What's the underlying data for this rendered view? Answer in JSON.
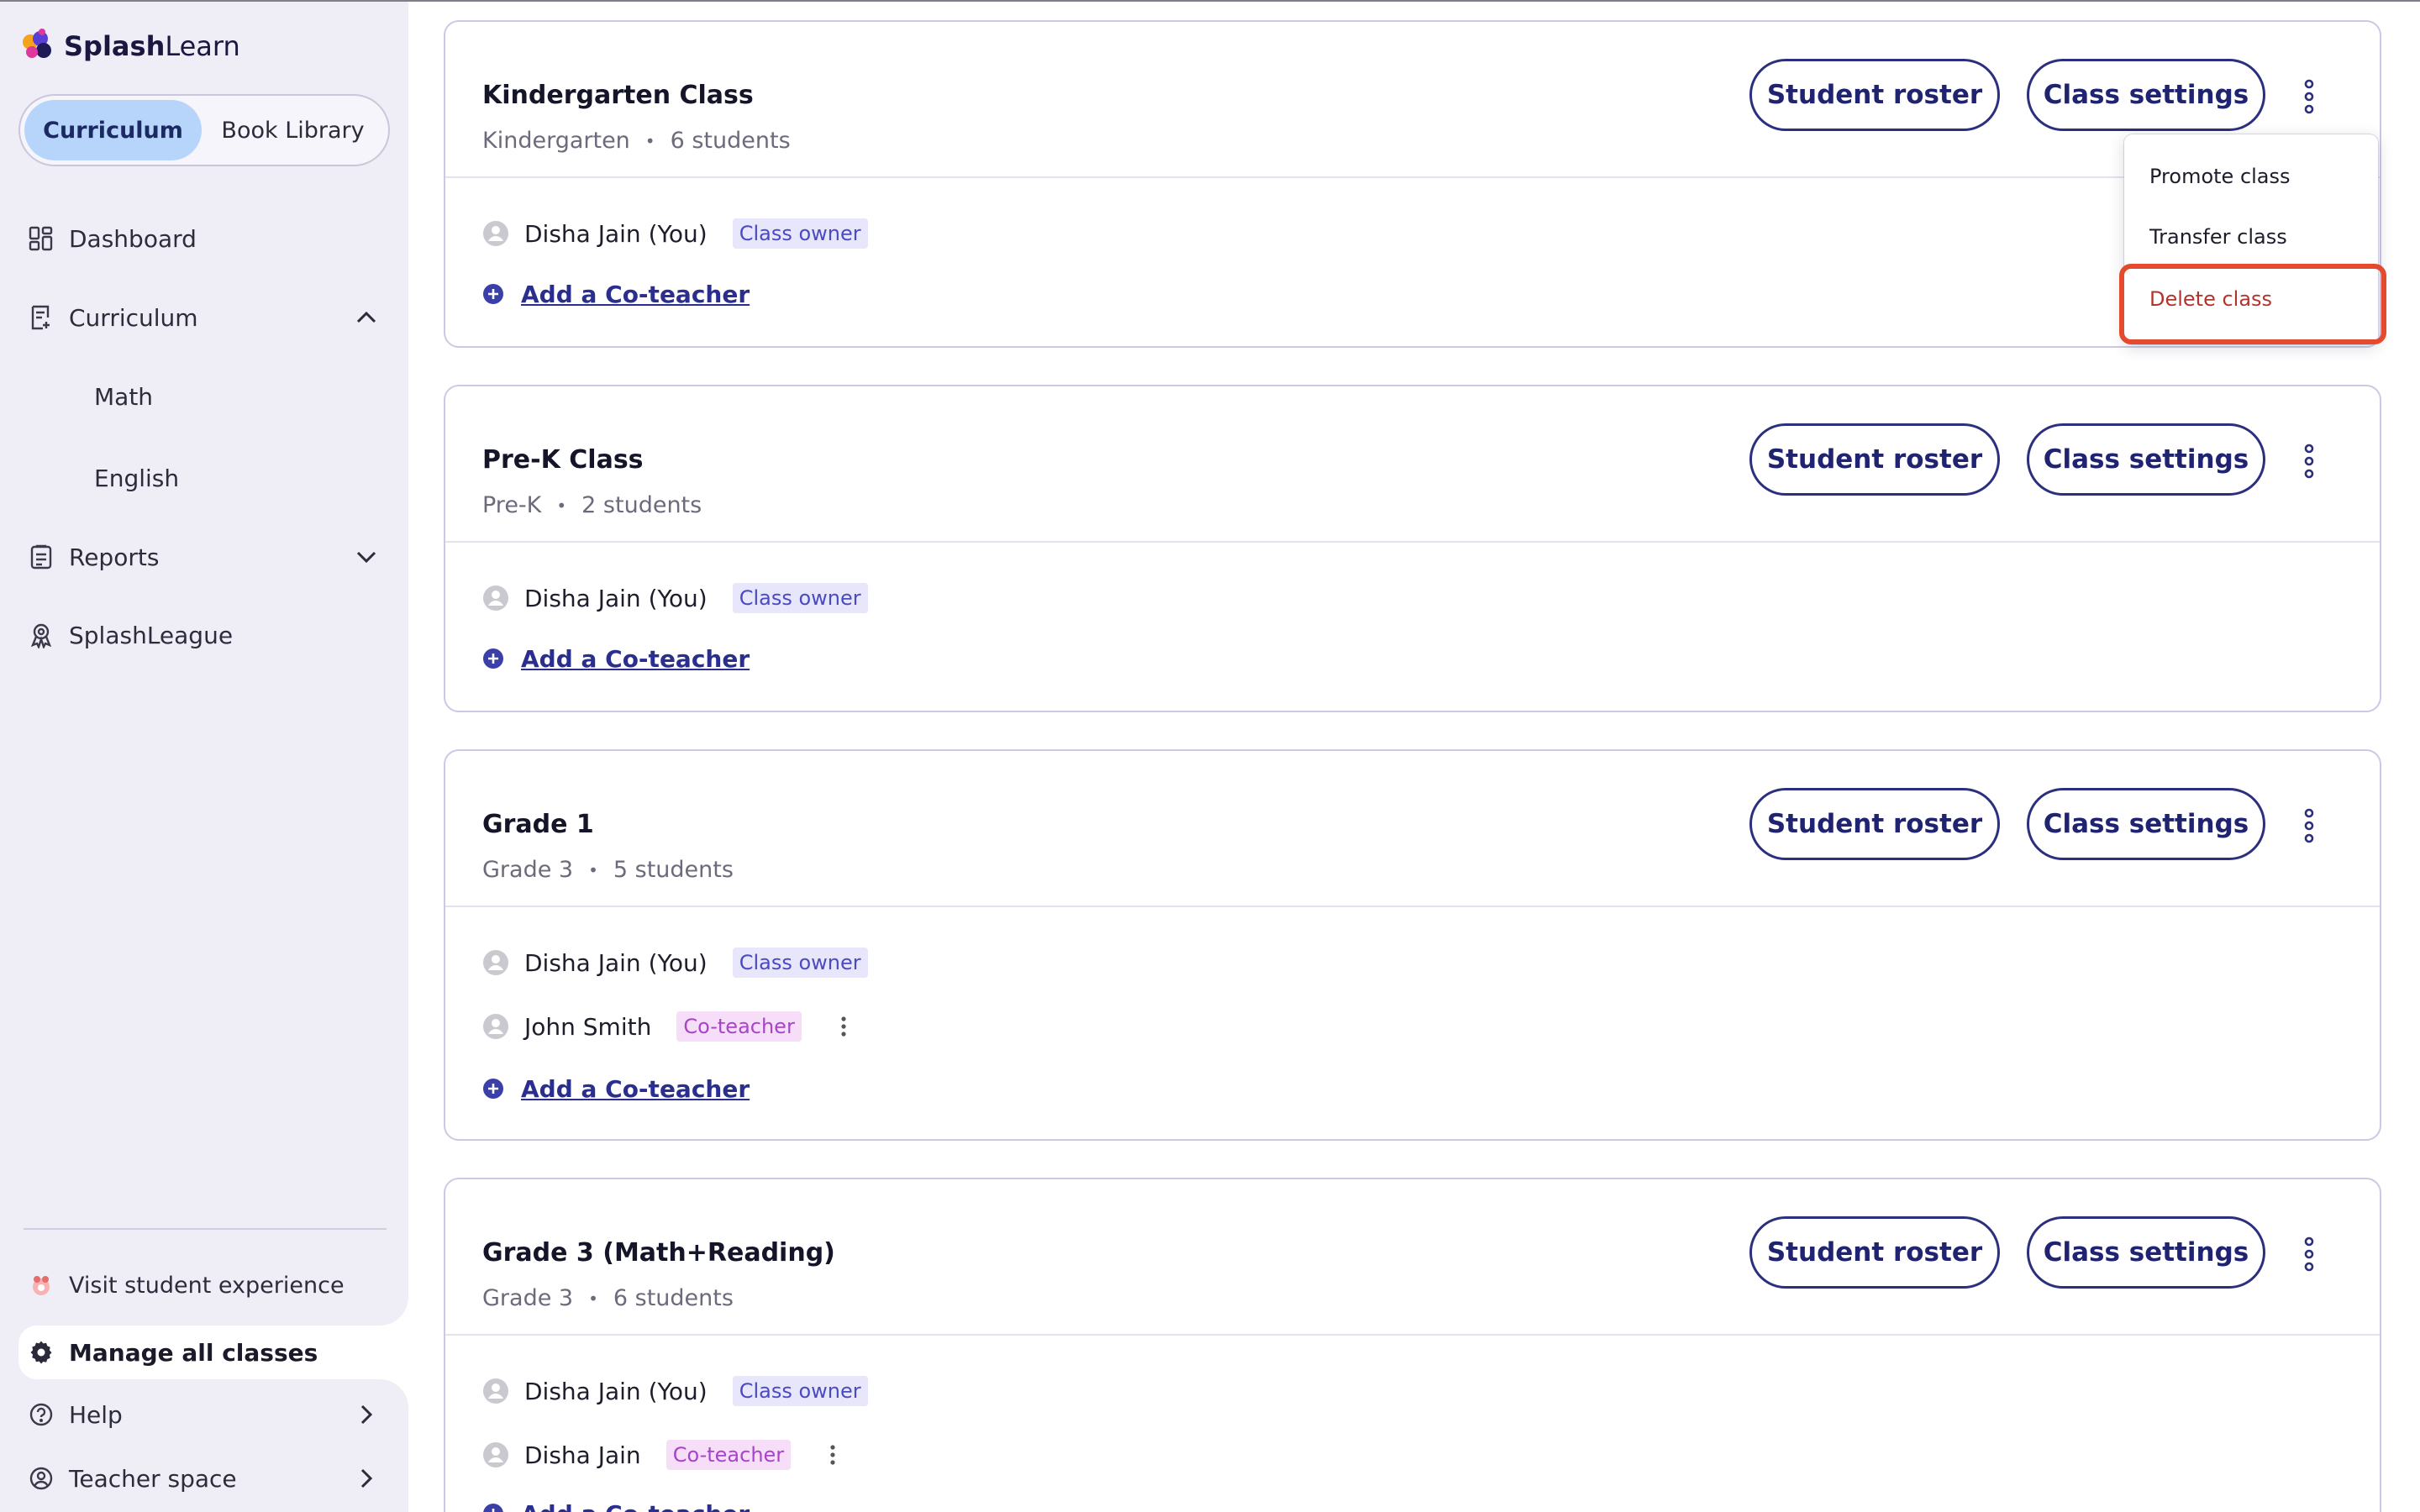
{
  "brand": {
    "name_bold": "Splash",
    "name_rest": "Learn",
    "colors": {
      "primary": "#2c2f7d",
      "toggle_active": "#b7d5fb",
      "delete": "#b3342c",
      "highlight": "#e34a2e"
    }
  },
  "sidebar": {
    "toggle": {
      "curriculum": "Curriculum",
      "book_library": "Book Library"
    },
    "nav": {
      "dashboard": "Dashboard",
      "curriculum": "Curriculum",
      "math": "Math",
      "english": "English",
      "reports": "Reports",
      "splashleague": "SplashLeague"
    },
    "bottom": {
      "visit_student": "Visit student experience",
      "manage_classes": "Manage all classes",
      "help": "Help",
      "teacher_space": "Teacher space"
    }
  },
  "buttons": {
    "student_roster": "Student roster",
    "class_settings": "Class settings"
  },
  "add_co_teacher": "Add a Co-teacher",
  "badges": {
    "owner": "Class owner",
    "co": "Co-teacher"
  },
  "classes": [
    {
      "title": "Kindergarten Class",
      "grade": "Kindergarten",
      "students": "6 students",
      "teachers": [
        {
          "name": "Disha Jain (You)",
          "role": "owner"
        }
      ]
    },
    {
      "title": "Pre-K Class",
      "grade": "Pre-K",
      "students": "2 students",
      "teachers": [
        {
          "name": "Disha Jain (You)",
          "role": "owner"
        }
      ]
    },
    {
      "title": "Grade 1",
      "grade": "Grade 3",
      "students": "5 students",
      "teachers": [
        {
          "name": "Disha Jain (You)",
          "role": "owner"
        },
        {
          "name": "John Smith",
          "role": "co"
        }
      ]
    },
    {
      "title": "Grade 3 (Math+Reading)",
      "grade": "Grade 3",
      "students": "6 students",
      "teachers": [
        {
          "name": "Disha Jain (You)",
          "role": "owner"
        },
        {
          "name": "Disha Jain",
          "role": "co"
        }
      ]
    }
  ],
  "dropdown": {
    "promote": "Promote class",
    "transfer": "Transfer class",
    "delete": "Delete class"
  }
}
